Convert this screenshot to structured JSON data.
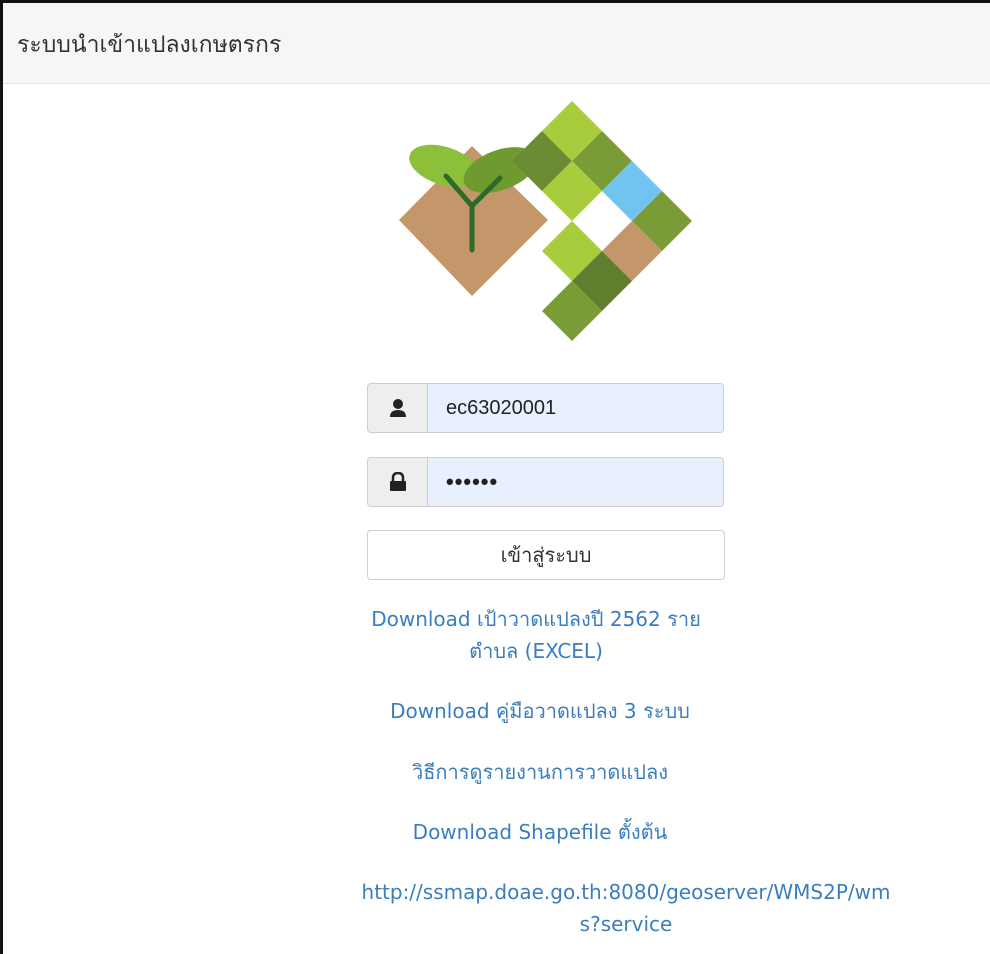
{
  "header": {
    "title": "ระบบนำเข้าแปลงเกษตรกร"
  },
  "logo": {
    "icon": "farm-plot-logo"
  },
  "login": {
    "username_icon": "user-icon",
    "username_value": "ec63020001",
    "password_icon": "lock-icon",
    "password_value": "••••••",
    "submit_label": "เข้าสู่ระบบ"
  },
  "links": [
    {
      "label": "Download เป้าวาดแปลงปี 2562 รายตำบล (EXCEL)"
    },
    {
      "label": "Download คู่มือวาดแปลง 3 ระบบ"
    },
    {
      "label": "วิธีการดูรายงานการวาดแปลง"
    },
    {
      "label": "Download Shapefile ตั้งต้น"
    },
    {
      "label": "http://ssmap.doae.go.th:8080/geoserver/WMS2P/wms?service"
    }
  ],
  "colors": {
    "link": "#3a7ebf",
    "light_green": "#a9cc3d",
    "mid_green": "#7a9c36",
    "dark_green": "#5f7f2f",
    "soil": "#c4976a",
    "sky": "#6fc5ef"
  }
}
